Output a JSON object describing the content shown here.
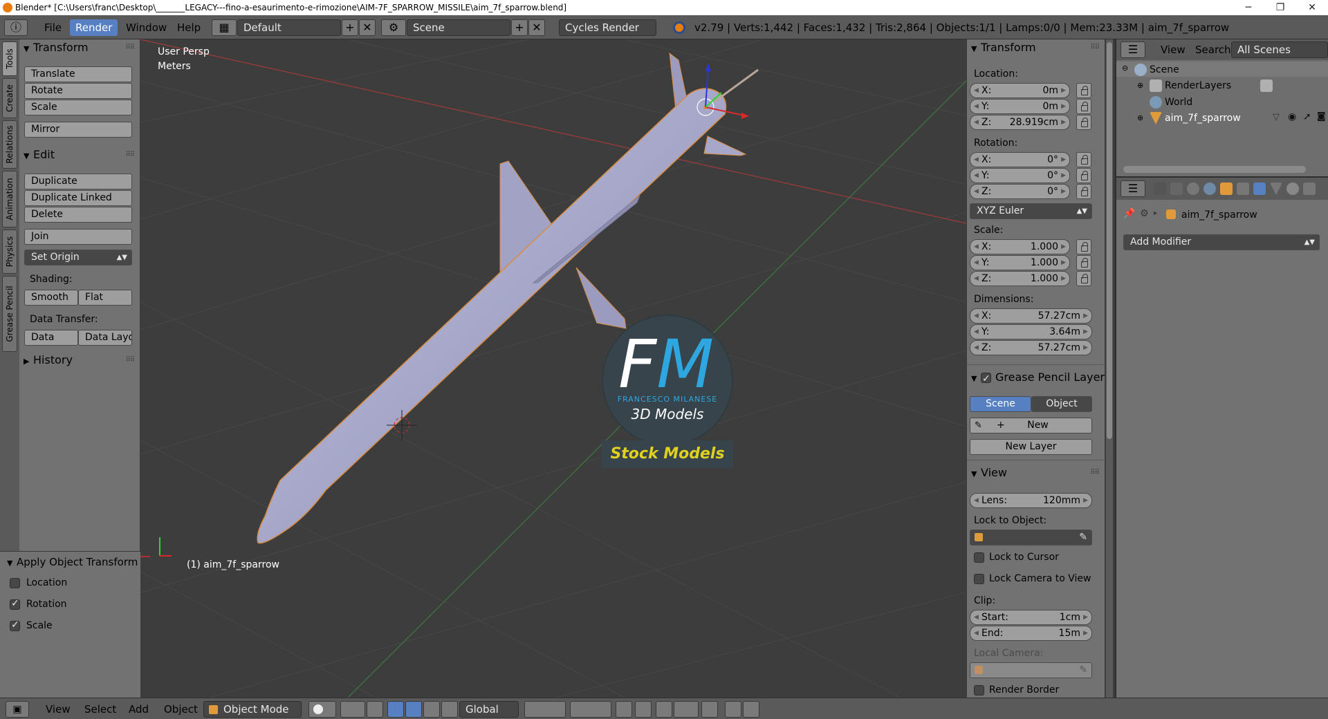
{
  "window": {
    "title": "Blender* [C:\\Users\\franc\\Desktop\\_______LEGACY---fino-a-esaurimento-e-rimozione\\AIM-7F_SPARROW_MISSILE\\aim_7f_sparrow.blend]",
    "minimize": "─",
    "maximize": "❐",
    "close": "✕"
  },
  "topbar": {
    "menus": [
      "File",
      "Render",
      "Window",
      "Help"
    ],
    "layout": "Default",
    "scene": "Scene",
    "engine": "Cycles Render",
    "stats": "v2.79 | Verts:1,442 | Faces:1,432 | Tris:2,864 | Objects:1/1 | Lamps:0/0 | Mem:23.33M | aim_7f_sparrow"
  },
  "vtabs": [
    "Tools",
    "Create",
    "Relations",
    "Animation",
    "Physics",
    "Grease Pencil"
  ],
  "shelf": {
    "transform": {
      "title": "Transform",
      "buttons": [
        "Translate",
        "Rotate",
        "Scale",
        "Mirror"
      ]
    },
    "edit": {
      "title": "Edit",
      "buttons": [
        "Duplicate",
        "Duplicate Linked",
        "Delete",
        "Join"
      ],
      "set_origin": "Set Origin",
      "shading_label": "Shading:",
      "smooth": "Smooth",
      "flat": "Flat",
      "data_transfer_label": "Data Transfer:",
      "data": "Data",
      "data_layout": "Data Layo"
    },
    "history": "History"
  },
  "operator": {
    "title": "Apply Object Transform",
    "options": [
      {
        "label": "Location",
        "checked": false
      },
      {
        "label": "Rotation",
        "checked": true
      },
      {
        "label": "Scale",
        "checked": true
      }
    ]
  },
  "viewport": {
    "view_name": "User Persp",
    "units": "Meters",
    "object_label": "(1) aim_7f_sparrow",
    "logo": {
      "letters_f": "F",
      "letters_m": "M",
      "company": "FRANCESCO MILANESE",
      "tagline": "3D Models",
      "banner": "Stock Models"
    }
  },
  "npanel": {
    "transform_title": "Transform",
    "location_label": "Location:",
    "location": [
      {
        "axis": "X:",
        "value": "0m"
      },
      {
        "axis": "Y:",
        "value": "0m"
      },
      {
        "axis": "Z:",
        "value": "28.919cm"
      }
    ],
    "rotation_label": "Rotation:",
    "rotation": [
      {
        "axis": "X:",
        "value": "0°"
      },
      {
        "axis": "Y:",
        "value": "0°"
      },
      {
        "axis": "Z:",
        "value": "0°"
      }
    ],
    "rotation_mode": "XYZ Euler",
    "scale_label": "Scale:",
    "scale": [
      {
        "axis": "X:",
        "value": "1.000"
      },
      {
        "axis": "Y:",
        "value": "1.000"
      },
      {
        "axis": "Z:",
        "value": "1.000"
      }
    ],
    "dimensions_label": "Dimensions:",
    "dimensions": [
      {
        "axis": "X:",
        "value": "57.27cm"
      },
      {
        "axis": "Y:",
        "value": "3.64m"
      },
      {
        "axis": "Z:",
        "value": "57.27cm"
      }
    ],
    "gp_title": "Grease Pencil Layer",
    "gp_scene": "Scene",
    "gp_object": "Object",
    "gp_new": "New",
    "gp_new_layer": "New Layer",
    "view_title": "View",
    "lens_label": "Lens:",
    "lens_value": "120mm",
    "lock_object_label": "Lock to Object:",
    "lock_cursor": "Lock to Cursor",
    "lock_camera": "Lock Camera to View",
    "clip_label": "Clip:",
    "clip_start_label": "Start:",
    "clip_start": "1cm",
    "clip_end_label": "End:",
    "clip_end": "15m",
    "local_camera_label": "Local Camera:",
    "render_border": "Render Border"
  },
  "outliner": {
    "view": "View",
    "search": "Search",
    "filter": "All Scenes",
    "items": [
      "Scene",
      "RenderLayers",
      "World",
      "aim_7f_sparrow"
    ]
  },
  "properties": {
    "object_name": "aim_7f_sparrow",
    "add_modifier": "Add Modifier"
  },
  "bottombar": {
    "menus": [
      "View",
      "Select",
      "Add",
      "Object"
    ],
    "mode": "Object Mode",
    "orientation": "Global"
  },
  "colors": {
    "accent": "#5680c2",
    "missile": "#a6a7c9",
    "logo_blue": "#2ea7e0",
    "banner_text": "#e0d020"
  }
}
